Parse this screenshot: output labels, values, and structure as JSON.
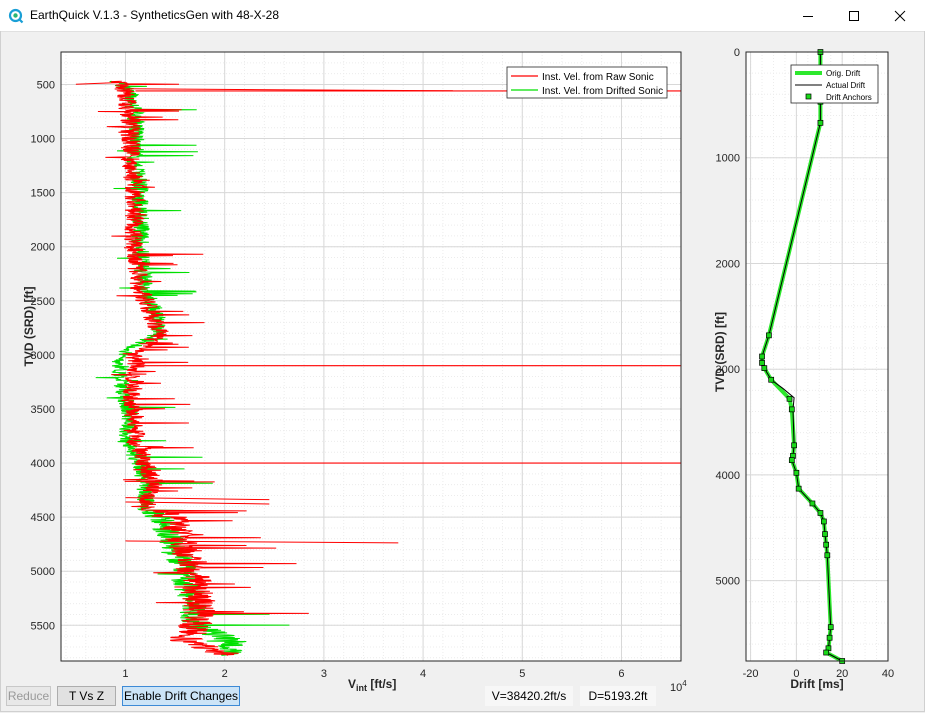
{
  "window": {
    "title": "EarthQuick V.1.3 - SyntheticsGen with 48-X-28"
  },
  "colors": {
    "raw": "#ff0000",
    "drifted": "#00e000",
    "orig_drift": "#2de82d",
    "actual_drift": "#000000",
    "anchor_fill": "#19d919",
    "grid": "#d8d8d8"
  },
  "chart_data": [
    {
      "type": "line",
      "orientation": "depth-vertical",
      "xlabel": "V",
      "xlabel_sub": "int",
      "xlabel_unit": " [ft/s]",
      "ylabel": "TVD (SRD) [ft]",
      "x_ticks": [
        "1",
        "2",
        "3",
        "4",
        "5",
        "6"
      ],
      "x_exponent": "10",
      "x_exponent_power": "4",
      "y_ticks": [
        "500",
        "1000",
        "1500",
        "2000",
        "2500",
        "3000",
        "3500",
        "4000",
        "4500",
        "5000",
        "5500"
      ],
      "xlim": [
        0.35,
        6.6
      ],
      "ylim": [
        5830,
        200
      ],
      "x_scale": 10000,
      "grid": true,
      "minor_grid": true,
      "legend_position": "top-right",
      "series": [
        {
          "name": "Inst. Vel. from Raw Sonic",
          "key": "raw"
        },
        {
          "name": "Inst. Vel. from Drifted Sonic",
          "key": "drifted"
        }
      ],
      "spikes_to_edge": [
        560,
        3100,
        4000
      ],
      "notable_spikes": [
        [
          480,
          0.5
        ],
        [
          540,
          4.3
        ],
        [
          4320,
          2.45
        ],
        [
          4360,
          2.45
        ],
        [
          4720,
          3.75
        ]
      ],
      "raw_profile": [
        [
          470,
          0.9
        ],
        [
          560,
          1.0
        ],
        [
          620,
          1.0
        ],
        [
          800,
          1.05
        ],
        [
          1000,
          1.05
        ],
        [
          1200,
          1.05
        ],
        [
          1500,
          1.1
        ],
        [
          2000,
          1.08
        ],
        [
          2400,
          1.15
        ],
        [
          2600,
          1.25
        ],
        [
          2800,
          1.35
        ],
        [
          3000,
          1.1
        ],
        [
          3200,
          1.1
        ],
        [
          3400,
          1.05
        ],
        [
          3600,
          1.1
        ],
        [
          3800,
          1.1
        ],
        [
          4000,
          1.2
        ],
        [
          4200,
          1.3
        ],
        [
          4400,
          1.2
        ],
        [
          4500,
          1.45
        ],
        [
          4700,
          1.55
        ],
        [
          4900,
          1.65
        ],
        [
          5100,
          1.7
        ],
        [
          5300,
          1.75
        ],
        [
          5500,
          1.7
        ],
        [
          5650,
          1.6
        ],
        [
          5780,
          2.1
        ]
      ],
      "drifted_profile": [
        [
          470,
          0.9
        ],
        [
          560,
          1.05
        ],
        [
          620,
          1.05
        ],
        [
          800,
          1.1
        ],
        [
          1000,
          1.1
        ],
        [
          1200,
          1.1
        ],
        [
          1500,
          1.15
        ],
        [
          2000,
          1.15
        ],
        [
          2400,
          1.2
        ],
        [
          2600,
          1.3
        ],
        [
          2800,
          1.35
        ],
        [
          3000,
          0.95
        ],
        [
          3200,
          0.95
        ],
        [
          3400,
          1.0
        ],
        [
          3600,
          1.05
        ],
        [
          3800,
          1.0
        ],
        [
          4000,
          1.15
        ],
        [
          4200,
          1.2
        ],
        [
          4400,
          1.2
        ],
        [
          4500,
          1.35
        ],
        [
          4700,
          1.45
        ],
        [
          4900,
          1.55
        ],
        [
          5100,
          1.6
        ],
        [
          5300,
          1.7
        ],
        [
          5500,
          1.7
        ],
        [
          5650,
          2.1
        ],
        [
          5780,
          2.0
        ]
      ]
    },
    {
      "type": "line",
      "orientation": "depth-vertical",
      "xlabel": "Drift [ms]",
      "ylabel": "TVD (SRD) [ft]",
      "x_ticks": [
        "-20",
        "0",
        "20",
        "40"
      ],
      "y_ticks": [
        "0",
        "1000",
        "2000",
        "3000",
        "4000",
        "5000"
      ],
      "xlim": [
        -22,
        40
      ],
      "ylim": [
        5760,
        0
      ],
      "grid": true,
      "minor_grid": true,
      "legend_position": "top-right",
      "series": [
        {
          "name": "Orig. Drift",
          "key": "orig_drift"
        },
        {
          "name": "Actual Drift",
          "key": "actual_drift"
        },
        {
          "name": "Drift Anchors",
          "key": "anchors"
        }
      ],
      "anchors": [
        [
          10.5,
          0
        ],
        [
          10.5,
          470
        ],
        [
          10.5,
          670
        ],
        [
          -12,
          2680
        ],
        [
          -15,
          2880
        ],
        [
          -15,
          2940
        ],
        [
          -14,
          2990
        ],
        [
          -11,
          3100
        ],
        [
          -3,
          3280
        ],
        [
          -2,
          3380
        ],
        [
          -1,
          3720
        ],
        [
          -1.5,
          3820
        ],
        [
          -2,
          3860
        ],
        [
          0,
          3980
        ],
        [
          1,
          4130
        ],
        [
          7,
          4270
        ],
        [
          10.5,
          4360
        ],
        [
          12,
          4440
        ],
        [
          12.5,
          4560
        ],
        [
          13,
          4660
        ],
        [
          13.5,
          4760
        ],
        [
          15,
          5440
        ],
        [
          14.5,
          5540
        ],
        [
          14,
          5640
        ],
        [
          13,
          5680
        ],
        [
          20,
          5760
        ]
      ],
      "actual_drift": [
        [
          10.5,
          0
        ],
        [
          10.5,
          470
        ],
        [
          10.5,
          670
        ],
        [
          -12,
          2680
        ],
        [
          -15,
          2880
        ],
        [
          -15,
          2940
        ],
        [
          -14,
          2990
        ],
        [
          -11,
          3100
        ],
        [
          -6,
          3180
        ],
        [
          -1,
          3270
        ],
        [
          -1.5,
          3380
        ],
        [
          -1,
          3720
        ],
        [
          -1.5,
          3820
        ],
        [
          -2,
          3860
        ],
        [
          0,
          3980
        ],
        [
          1,
          4130
        ],
        [
          7,
          4270
        ],
        [
          10.5,
          4360
        ],
        [
          12,
          4440
        ],
        [
          12.5,
          4560
        ],
        [
          13,
          4660
        ],
        [
          13.5,
          4760
        ],
        [
          15,
          5440
        ],
        [
          14.5,
          5540
        ],
        [
          14,
          5640
        ],
        [
          13,
          5680
        ],
        [
          20,
          5760
        ]
      ]
    }
  ],
  "toolbar": {
    "reduce": "Reduce",
    "t_vs_z": "T Vs Z",
    "enable_drift": "Enable Drift Changes"
  },
  "status": {
    "velocity": "V=38420.2ft/s",
    "depth": "D=5193.2ft"
  }
}
